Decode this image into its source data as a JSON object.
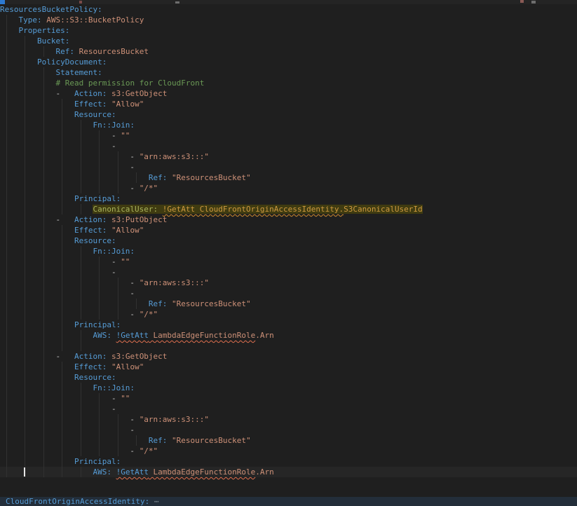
{
  "editor": {
    "background": "#1f1f1f",
    "colors": {
      "key": "#569cd6",
      "string": "#ce9178",
      "comment": "#6a9955",
      "punctuation": "#c8c8c8",
      "indent_guide": "#313131",
      "squiggle": "#e0704f",
      "highlight_background": "#3f3b11",
      "highlight_key": "#a9b45c",
      "highlight_value": "#cf9a3f",
      "cursor": "#e8e8e8",
      "folded_bar_background": "#232e3a"
    },
    "folded_line": {
      "label": "CloudFrontOriginAccessIdentity:",
      "ellipsis": " ⋯"
    },
    "lines": [
      {
        "g": 0,
        "seg": [
          {
            "c": "k",
            "t": "ResourcesBucketPolicy:"
          }
        ]
      },
      {
        "g": 1,
        "seg": [
          {
            "c": "p",
            "t": "    "
          },
          {
            "c": "k",
            "t": "Type:"
          },
          {
            "c": "p",
            "t": " "
          },
          {
            "c": "v",
            "t": "AWS::S3::BucketPolicy"
          }
        ]
      },
      {
        "g": 1,
        "seg": [
          {
            "c": "p",
            "t": "    "
          },
          {
            "c": "k",
            "t": "Properties:"
          }
        ]
      },
      {
        "g": 2,
        "seg": [
          {
            "c": "p",
            "t": "        "
          },
          {
            "c": "k",
            "t": "Bucket:"
          }
        ]
      },
      {
        "g": 3,
        "seg": [
          {
            "c": "p",
            "t": "            "
          },
          {
            "c": "k",
            "t": "Ref:"
          },
          {
            "c": "p",
            "t": " "
          },
          {
            "c": "v",
            "t": "ResourcesBucket"
          }
        ]
      },
      {
        "g": 2,
        "seg": [
          {
            "c": "p",
            "t": "        "
          },
          {
            "c": "k",
            "t": "PolicyDocument:"
          }
        ]
      },
      {
        "g": 3,
        "seg": [
          {
            "c": "p",
            "t": "            "
          },
          {
            "c": "k",
            "t": "Statement:"
          }
        ]
      },
      {
        "g": 3,
        "seg": [
          {
            "c": "p",
            "t": "            "
          },
          {
            "c": "c",
            "t": "# Read permission for CloudFront"
          }
        ]
      },
      {
        "g": 3,
        "seg": [
          {
            "c": "p",
            "t": "            -   "
          },
          {
            "c": "k",
            "t": "Action:"
          },
          {
            "c": "p",
            "t": " "
          },
          {
            "c": "v",
            "t": "s3:GetObject"
          }
        ]
      },
      {
        "g": 4,
        "seg": [
          {
            "c": "p",
            "t": "                "
          },
          {
            "c": "k",
            "t": "Effect:"
          },
          {
            "c": "p",
            "t": " "
          },
          {
            "c": "v",
            "t": "\"Allow\""
          }
        ]
      },
      {
        "g": 4,
        "seg": [
          {
            "c": "p",
            "t": "                "
          },
          {
            "c": "k",
            "t": "Resource:"
          }
        ]
      },
      {
        "g": 5,
        "seg": [
          {
            "c": "p",
            "t": "                    "
          },
          {
            "c": "k",
            "t": "Fn::Join:"
          }
        ]
      },
      {
        "g": 6,
        "seg": [
          {
            "c": "p",
            "t": "                        - "
          },
          {
            "c": "v",
            "t": "\"\""
          }
        ]
      },
      {
        "g": 6,
        "seg": [
          {
            "c": "p",
            "t": "                        -"
          }
        ]
      },
      {
        "g": 7,
        "seg": [
          {
            "c": "p",
            "t": "                            - "
          },
          {
            "c": "v",
            "t": "\"arn:aws:s3:::\""
          }
        ]
      },
      {
        "g": 7,
        "seg": [
          {
            "c": "p",
            "t": "                            -"
          }
        ]
      },
      {
        "g": 8,
        "seg": [
          {
            "c": "p",
            "t": "                                "
          },
          {
            "c": "k",
            "t": "Ref:"
          },
          {
            "c": "p",
            "t": " "
          },
          {
            "c": "v",
            "t": "\"ResourcesBucket\""
          }
        ]
      },
      {
        "g": 7,
        "seg": [
          {
            "c": "p",
            "t": "                            - "
          },
          {
            "c": "v",
            "t": "\"/*\""
          }
        ]
      },
      {
        "g": 4,
        "seg": [
          {
            "c": "p",
            "t": "                "
          },
          {
            "c": "k",
            "t": "Principal:"
          }
        ]
      },
      {
        "g": 5,
        "seg": [
          {
            "c": "p",
            "t": "                    "
          },
          {
            "c": "hk",
            "t": "CanonicalUser:",
            "h": 1
          },
          {
            "c": "hp",
            "t": " ",
            "h": 1
          },
          {
            "c": "hv",
            "t": "!GetAtt CloudFrontOriginAccessIdentity.",
            "h": 1
          },
          {
            "c": "hv2",
            "t": "S3CanonicalUserId",
            "h": 1
          }
        ]
      },
      {
        "g": 3,
        "seg": [
          {
            "c": "p",
            "t": "            -   "
          },
          {
            "c": "k",
            "t": "Action:"
          },
          {
            "c": "p",
            "t": " "
          },
          {
            "c": "v",
            "t": "s3:PutObject"
          }
        ]
      },
      {
        "g": 4,
        "seg": [
          {
            "c": "p",
            "t": "                "
          },
          {
            "c": "k",
            "t": "Effect:"
          },
          {
            "c": "p",
            "t": " "
          },
          {
            "c": "v",
            "t": "\"Allow\""
          }
        ]
      },
      {
        "g": 4,
        "seg": [
          {
            "c": "p",
            "t": "                "
          },
          {
            "c": "k",
            "t": "Resource:"
          }
        ]
      },
      {
        "g": 5,
        "seg": [
          {
            "c": "p",
            "t": "                    "
          },
          {
            "c": "k",
            "t": "Fn::Join:"
          }
        ]
      },
      {
        "g": 6,
        "seg": [
          {
            "c": "p",
            "t": "                        - "
          },
          {
            "c": "v",
            "t": "\"\""
          }
        ]
      },
      {
        "g": 6,
        "seg": [
          {
            "c": "p",
            "t": "                        -"
          }
        ]
      },
      {
        "g": 7,
        "seg": [
          {
            "c": "p",
            "t": "                            - "
          },
          {
            "c": "v",
            "t": "\"arn:aws:s3:::\""
          }
        ]
      },
      {
        "g": 7,
        "seg": [
          {
            "c": "p",
            "t": "                            -"
          }
        ]
      },
      {
        "g": 8,
        "seg": [
          {
            "c": "p",
            "t": "                                "
          },
          {
            "c": "k",
            "t": "Ref:"
          },
          {
            "c": "p",
            "t": " "
          },
          {
            "c": "v",
            "t": "\"ResourcesBucket\""
          }
        ]
      },
      {
        "g": 7,
        "seg": [
          {
            "c": "p",
            "t": "                            - "
          },
          {
            "c": "v",
            "t": "\"/*\""
          }
        ]
      },
      {
        "g": 4,
        "seg": [
          {
            "c": "p",
            "t": "                "
          },
          {
            "c": "k",
            "t": "Principal:"
          }
        ]
      },
      {
        "g": 5,
        "seg": [
          {
            "c": "p",
            "t": "                    "
          },
          {
            "c": "k",
            "t": "AWS:"
          },
          {
            "c": "p",
            "t": " "
          },
          {
            "c": "sqf",
            "t": "!GetAtt"
          },
          {
            "c": "sqv",
            "t": " LambdaEdgeFunctionRole"
          },
          {
            "c": "v",
            "t": ".Arn"
          }
        ]
      },
      {
        "g": 5,
        "seg": []
      },
      {
        "g": 3,
        "seg": [
          {
            "c": "p",
            "t": "            -   "
          },
          {
            "c": "k",
            "t": "Action:"
          },
          {
            "c": "p",
            "t": " "
          },
          {
            "c": "v",
            "t": "s3:GetObject"
          }
        ]
      },
      {
        "g": 4,
        "seg": [
          {
            "c": "p",
            "t": "                "
          },
          {
            "c": "k",
            "t": "Effect:"
          },
          {
            "c": "p",
            "t": " "
          },
          {
            "c": "v",
            "t": "\"Allow\""
          }
        ]
      },
      {
        "g": 4,
        "seg": [
          {
            "c": "p",
            "t": "                "
          },
          {
            "c": "k",
            "t": "Resource:"
          }
        ]
      },
      {
        "g": 5,
        "seg": [
          {
            "c": "p",
            "t": "                    "
          },
          {
            "c": "k",
            "t": "Fn::Join:"
          }
        ]
      },
      {
        "g": 6,
        "seg": [
          {
            "c": "p",
            "t": "                        - "
          },
          {
            "c": "v",
            "t": "\"\""
          }
        ]
      },
      {
        "g": 6,
        "seg": [
          {
            "c": "p",
            "t": "                        -"
          }
        ]
      },
      {
        "g": 7,
        "seg": [
          {
            "c": "p",
            "t": "                            - "
          },
          {
            "c": "v",
            "t": "\"arn:aws:s3:::\""
          }
        ]
      },
      {
        "g": 7,
        "seg": [
          {
            "c": "p",
            "t": "                            -"
          }
        ]
      },
      {
        "g": 8,
        "seg": [
          {
            "c": "p",
            "t": "                                "
          },
          {
            "c": "k",
            "t": "Ref:"
          },
          {
            "c": "p",
            "t": " "
          },
          {
            "c": "v",
            "t": "\"ResourcesBucket\""
          }
        ]
      },
      {
        "g": 7,
        "seg": [
          {
            "c": "p",
            "t": "                            - "
          },
          {
            "c": "v",
            "t": "\"/*\""
          }
        ]
      },
      {
        "g": 4,
        "seg": [
          {
            "c": "p",
            "t": "                "
          },
          {
            "c": "k",
            "t": "Principal:"
          }
        ]
      },
      {
        "g": 5,
        "cur": true,
        "cursor": true,
        "seg": [
          {
            "c": "p",
            "t": "                    "
          },
          {
            "c": "k",
            "t": "AWS:"
          },
          {
            "c": "p",
            "t": " "
          },
          {
            "c": "sqf",
            "t": "!GetAtt"
          },
          {
            "c": "sqv",
            "t": " LambdaEdgeFunctionRole"
          },
          {
            "c": "v",
            "t": ".Arn"
          }
        ]
      }
    ]
  }
}
